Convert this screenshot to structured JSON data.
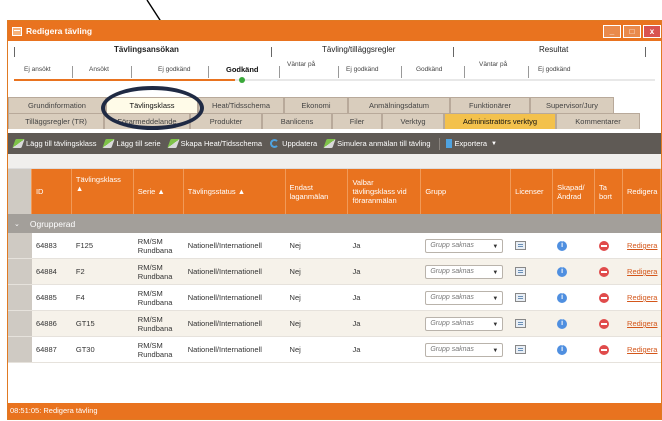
{
  "window": {
    "title": "Redigera tävling",
    "buttons": {
      "minimize": "_",
      "maximize": "□",
      "close": "x"
    }
  },
  "status_header": {
    "stages": [
      {
        "label": "Tävlingsansökan"
      },
      {
        "label": "Tävling/tilläggsregler"
      },
      {
        "label": "Resultat"
      }
    ],
    "substatuses": [
      {
        "label": "Ej ansökt"
      },
      {
        "label": "Ansökt"
      },
      {
        "label": "Ej godkänd"
      },
      {
        "label": "Godkänd",
        "current": true
      },
      {
        "label": "Väntar på"
      },
      {
        "label": "Ej godkänd"
      },
      {
        "label": "Godkänd"
      },
      {
        "label": "Väntar på"
      },
      {
        "label": "Ej godkänd"
      }
    ]
  },
  "tabs_row1": [
    "Grundinformation",
    "Tävlingsklass",
    "Heat/Tidsschema",
    "Ekonomi",
    "Anmälningsdatum",
    "Funktionärer",
    "Supervisor/Jury"
  ],
  "tabs_row2": [
    "Tilläggsregler (TR)",
    "Förarmeddelande",
    "Produkter",
    "Banlicens",
    "Filer",
    "Verktyg",
    "Administratörs verktyg",
    "Kommentarer"
  ],
  "active_tab": "Tävlingsklass",
  "toolbar": {
    "add_class": "Lägg till tävlingsklass",
    "add_series": "Lägg till serie",
    "create_heat": "Skapa Heat/Tidsschema",
    "update": "Uppdatera",
    "simulate": "Simulera anmälan till tävling",
    "export": "Exportera"
  },
  "grid": {
    "headers": {
      "id": "ID",
      "class": "Tävlingsklass",
      "series": "Serie",
      "status": "Tävlingsstatus",
      "team_only": "Endast laganmälan",
      "selectable": "Valbar tävlingsklass vid föraranmälan",
      "group": "Grupp",
      "licenses": "Licenser",
      "created": "Skapad/ Ändrad",
      "delete": "Ta bort",
      "edit": "Redigera"
    },
    "sort_arrows": {
      "class": "▲",
      "series": "▲",
      "status": "▲"
    },
    "group_label": "Ogrupperad",
    "group_chevron": "⌄",
    "rows": [
      {
        "id": "64883",
        "class": "F125",
        "series": "RM/SM Rundbana",
        "status": "Nationell/Internationell",
        "team_only": "Nej",
        "selectable": "Ja",
        "group": "Grupp saknas",
        "edit": "Redigera"
      },
      {
        "id": "64884",
        "class": "F2",
        "series": "RM/SM Rundbana",
        "status": "Nationell/Internationell",
        "team_only": "Nej",
        "selectable": "Ja",
        "group": "Grupp saknas",
        "edit": "Redigera"
      },
      {
        "id": "64885",
        "class": "F4",
        "series": "RM/SM Rundbana",
        "status": "Nationell/Internationell",
        "team_only": "Nej",
        "selectable": "Ja",
        "group": "Grupp saknas",
        "edit": "Redigera"
      },
      {
        "id": "64886",
        "class": "GT15",
        "series": "RM/SM Rundbana",
        "status": "Nationell/Internationell",
        "team_only": "Nej",
        "selectable": "Ja",
        "group": "Grupp saknas",
        "edit": "Redigera"
      },
      {
        "id": "64887",
        "class": "GT30",
        "series": "RM/SM Rundbana",
        "status": "Nationell/Internationell",
        "team_only": "Nej",
        "selectable": "Ja",
        "group": "Grupp saknas",
        "edit": "Redigera"
      }
    ]
  },
  "statusbar": {
    "text": "08:51:05: Redigera tävling"
  },
  "colors": {
    "accent": "#e9731f",
    "toolbar": "#5f5a55",
    "admin_tab": "#f3c14c",
    "annotation": "#1f2a44"
  }
}
